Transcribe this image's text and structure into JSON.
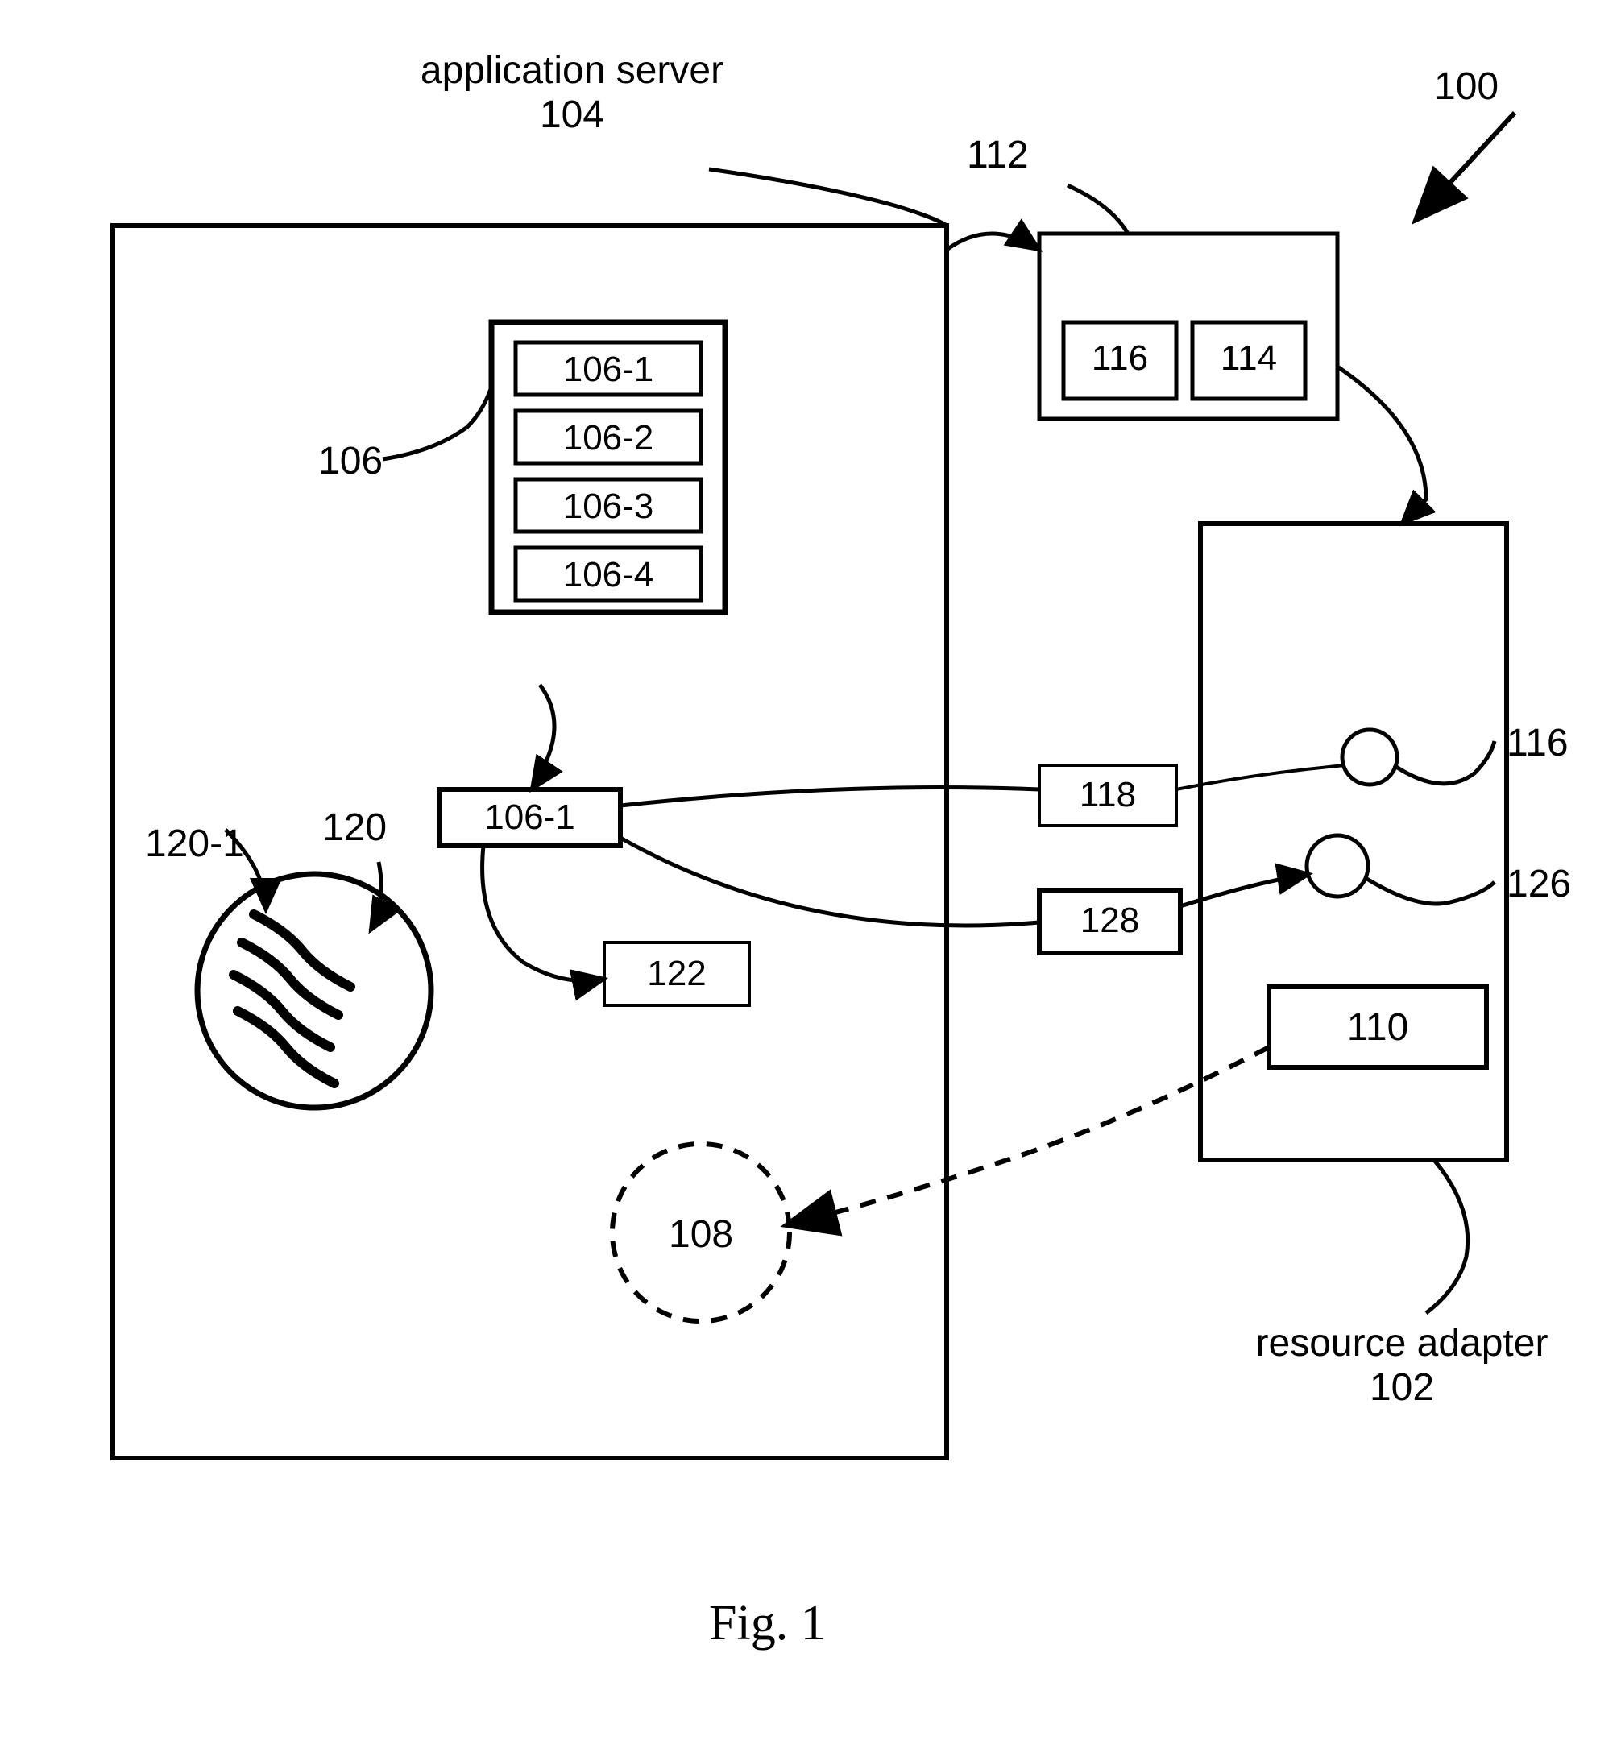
{
  "title": {
    "app_server_label": "application server",
    "app_server_num": "104",
    "resource_adapter_label": "resource adapter",
    "resource_adapter_num": "102",
    "overall_num": "100",
    "fig_label": "Fig. 1"
  },
  "pool": {
    "pool_num": "106",
    "items": [
      "106-1",
      "106-2",
      "106-3",
      "106-4"
    ]
  },
  "box112": {
    "num": "112",
    "left": "116",
    "right": "114"
  },
  "labels": {
    "l106_1": "106-1",
    "l118": "118",
    "l116": "116",
    "l128": "128",
    "l126": "126",
    "l120": "120",
    "l120_1": "120-1",
    "l122": "122",
    "l110": "110",
    "l108": "108"
  }
}
